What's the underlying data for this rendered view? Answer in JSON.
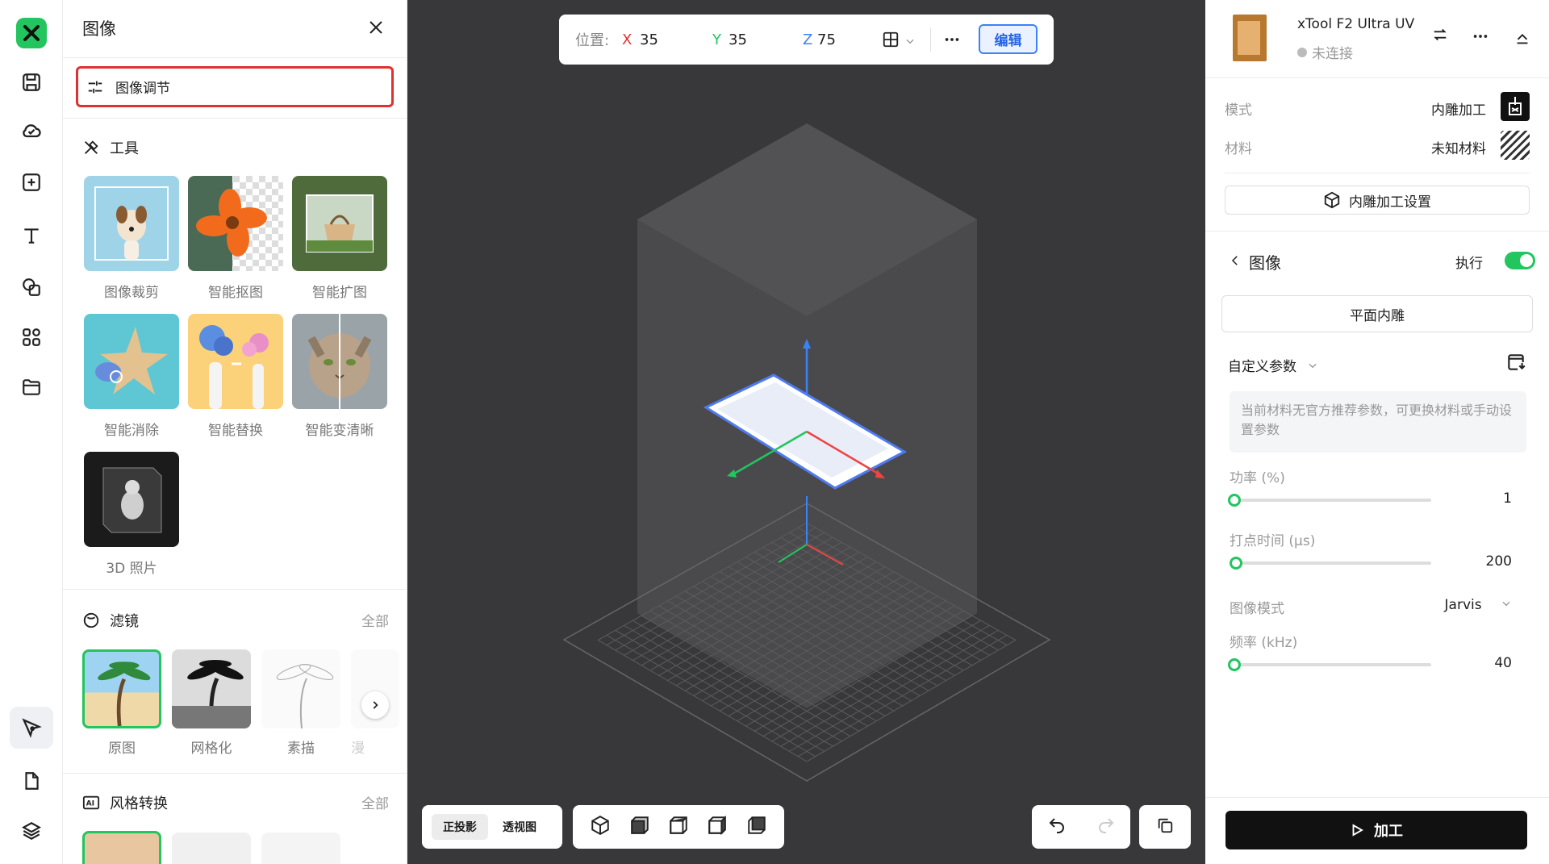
{
  "left_panel": {
    "title": "图像",
    "image_adjust_label": "图像调节",
    "tools_title": "工具",
    "tools": [
      {
        "label": "图像裁剪"
      },
      {
        "label": "智能抠图"
      },
      {
        "label": "智能扩图"
      },
      {
        "label": "智能消除"
      },
      {
        "label": "智能替换"
      },
      {
        "label": "智能变清晰"
      },
      {
        "label": "3D 照片"
      }
    ],
    "filters_title": "滤镜",
    "filters_all": "全部",
    "filters": [
      {
        "label": "原图",
        "selected": true
      },
      {
        "label": "网格化"
      },
      {
        "label": "素描"
      },
      {
        "label": "漫"
      }
    ],
    "style_title": "风格转换",
    "style_all": "全部"
  },
  "toolbar": {
    "position_label": "位置:",
    "x_label": "X",
    "x_value": "35",
    "y_label": "Y",
    "y_value": "35",
    "z_label": "Z",
    "z_value": "75",
    "edit_label": "编辑"
  },
  "view_toggle": {
    "ortho": "正投影",
    "persp": "透视图"
  },
  "right_panel": {
    "device_name": "xTool F2 Ultra UV",
    "device_status": "未连接",
    "mode_label": "模式",
    "mode_value": "内雕加工",
    "material_label": "材料",
    "material_value": "未知材料",
    "settings_btn": "内雕加工设置",
    "layer_title": "图像",
    "execute_label": "执行",
    "execute_on": true,
    "engrave_type": "平面内雕",
    "custom_params": "自定义参数",
    "note": "当前材料无官方推荐参数，可更换材料或手动设置参数",
    "power_label": "功率 (%)",
    "power_value": "1",
    "dot_time_label": "打点时间 (µs)",
    "dot_time_value": "200",
    "image_mode_label": "图像模式",
    "image_mode_value": "Jarvis",
    "freq_label": "频率 (kHz)",
    "freq_value": "40",
    "process_btn": "加工"
  },
  "colors": {
    "accent": "#22c55e",
    "highlight": "#e03131",
    "edit_blue": "#2563eb",
    "canvas_bg": "#38383b"
  }
}
